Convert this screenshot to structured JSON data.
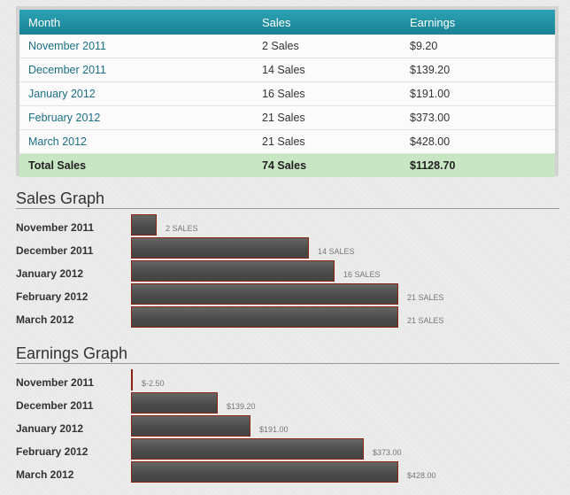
{
  "table": {
    "headers": [
      "Month",
      "Sales",
      "Earnings"
    ],
    "rows": [
      {
        "month": "November 2011",
        "sales": "2 Sales",
        "earnings": "$9.20"
      },
      {
        "month": "December 2011",
        "sales": "14 Sales",
        "earnings": "$139.20"
      },
      {
        "month": "January 2012",
        "sales": "16 Sales",
        "earnings": "$191.00"
      },
      {
        "month": "February 2012",
        "sales": "21 Sales",
        "earnings": "$373.00"
      },
      {
        "month": "March 2012",
        "sales": "21 Sales",
        "earnings": "$428.00"
      }
    ],
    "total": {
      "month": "Total Sales",
      "sales": "74 Sales",
      "earnings": "$1128.70"
    }
  },
  "sales_graph": {
    "title": "Sales Graph",
    "rows": [
      {
        "label": "November 2011",
        "value": 2,
        "value_label": "2 SALES"
      },
      {
        "label": "December 2011",
        "value": 14,
        "value_label": "14 SALES"
      },
      {
        "label": "January 2012",
        "value": 16,
        "value_label": "16 SALES"
      },
      {
        "label": "February 2012",
        "value": 21,
        "value_label": "21 SALES"
      },
      {
        "label": "March 2012",
        "value": 21,
        "value_label": "21 SALES"
      }
    ]
  },
  "earnings_graph": {
    "title": "Earnings Graph",
    "rows": [
      {
        "label": "November 2011",
        "value": -2.5,
        "value_label": "$-2.50"
      },
      {
        "label": "December 2011",
        "value": 139.2,
        "value_label": "$139.20"
      },
      {
        "label": "January 2012",
        "value": 191.0,
        "value_label": "$191.00"
      },
      {
        "label": "February 2012",
        "value": 373.0,
        "value_label": "$373.00"
      },
      {
        "label": "March 2012",
        "value": 428.0,
        "value_label": "$428.00"
      }
    ]
  },
  "colors": {
    "header": "#1f93a6",
    "total_row": "#c8e6c3",
    "bar_fill": "#555555",
    "bar_border": "#8a2515",
    "month_link": "#1b6f85"
  }
}
